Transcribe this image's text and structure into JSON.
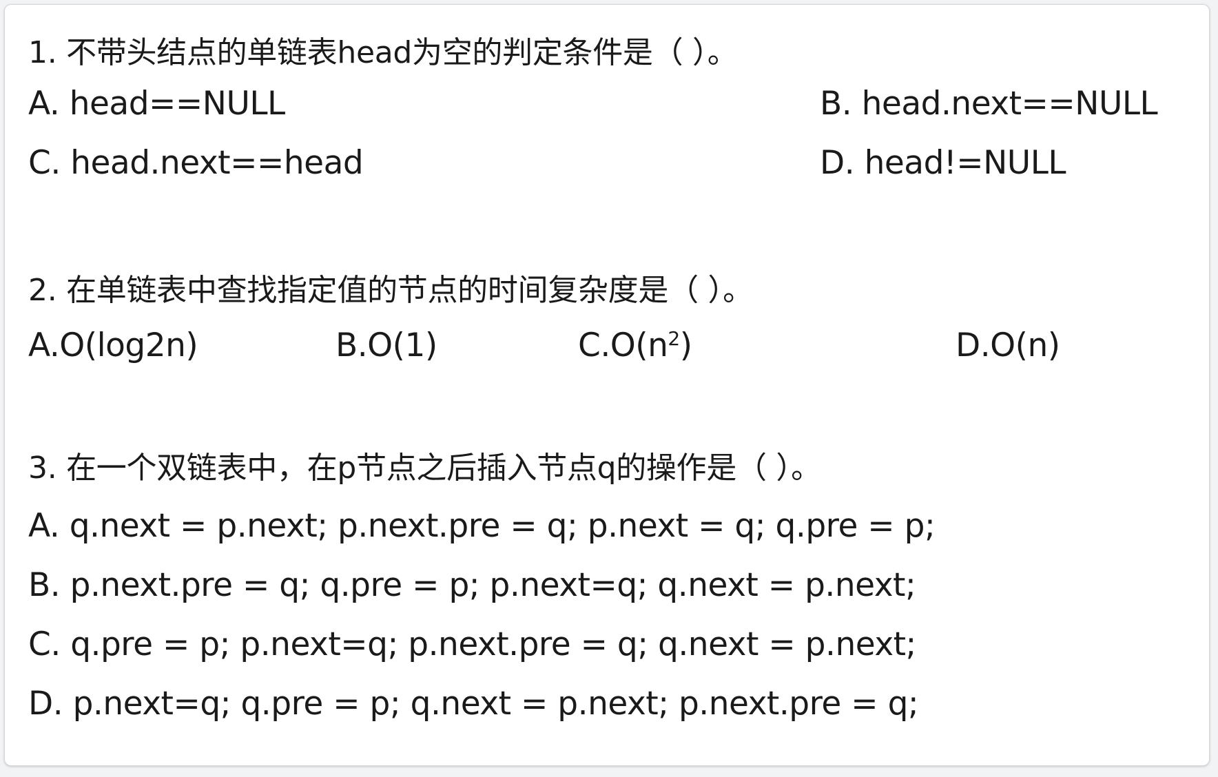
{
  "questions": [
    {
      "stem": "1. 不带头结点的单链表head为空的判定条件是（    ）。",
      "options": {
        "A": "A. head==NULL",
        "B": "B. head.next==NULL",
        "C": "C. head.next==head",
        "D": "D. head!=NULL"
      }
    },
    {
      "stem": "2. 在单链表中查找指定值的节点的时间复杂度是（  ）。",
      "options": {
        "A": "A.O(log2n)",
        "B": "B.O(1)",
        "C_prefix": "C.O(n",
        "C_sup": "2",
        "C_suffix": ")",
        "D": "D.O(n)"
      }
    },
    {
      "stem": "3. 在一个双链表中，在p节点之后插入节点q的操作是（  ）。",
      "options": {
        "A": "A. q.next = p.next; p.next.pre = q; p.next = q; q.pre = p;",
        "B": "B. p.next.pre = q; q.pre = p; p.next=q; q.next = p.next;",
        "C": "C. q.pre = p; p.next=q; p.next.pre = q; q.next = p.next;",
        "D": "D. p.next=q; q.pre = p; q.next = p.next; p.next.pre = q;"
      }
    }
  ]
}
